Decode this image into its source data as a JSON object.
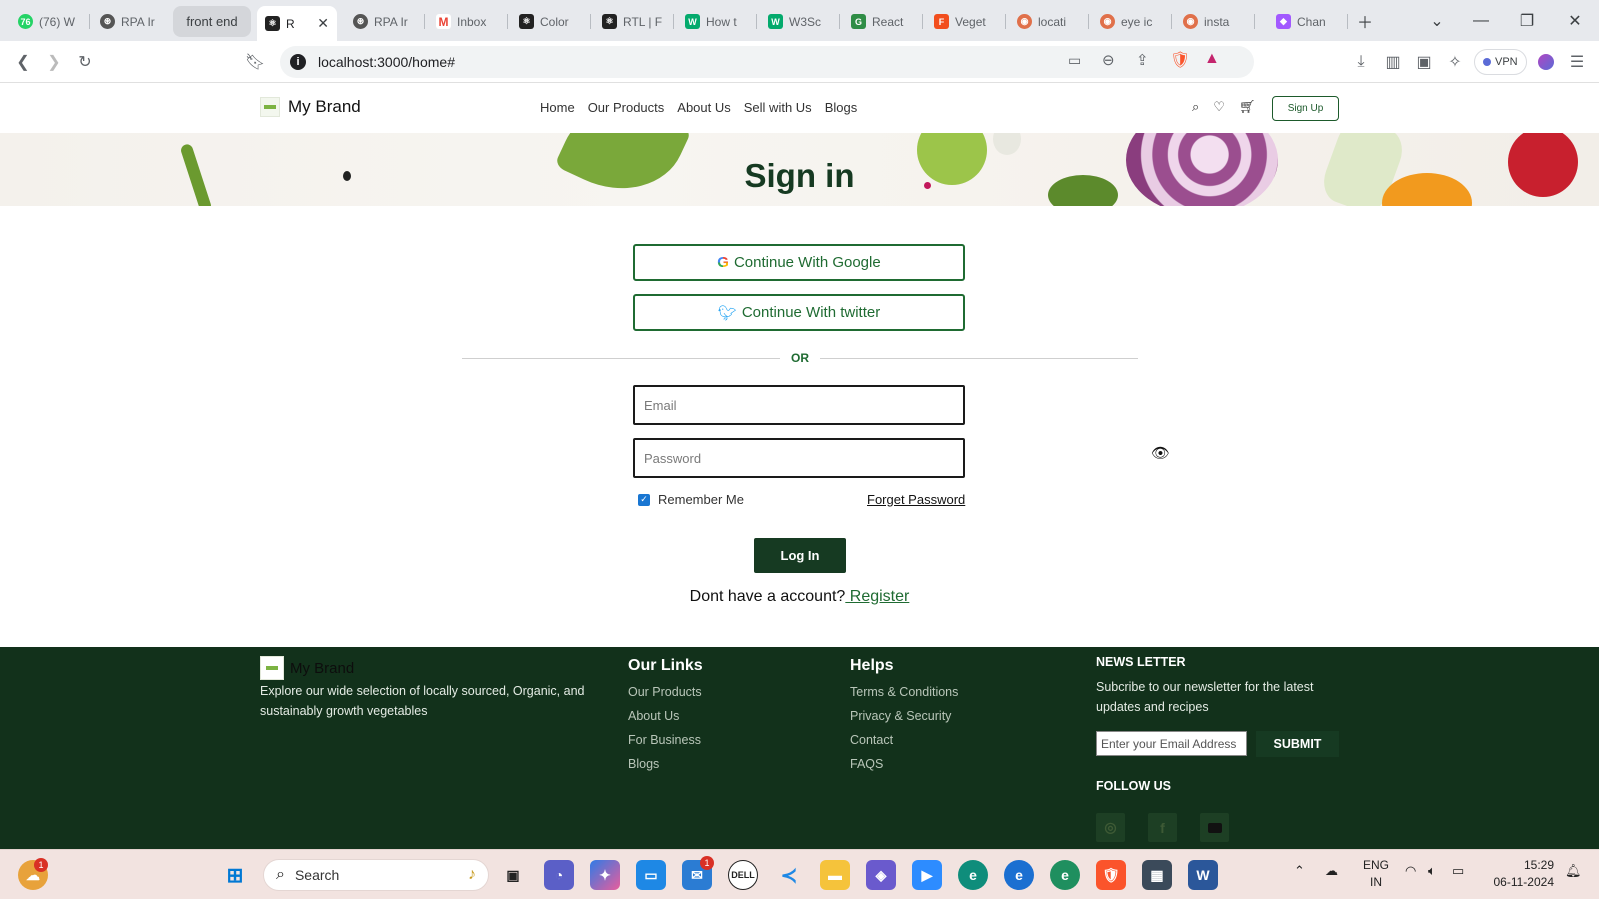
{
  "browser": {
    "tabs": [
      {
        "label": "(76) W",
        "icon": "whatsapp-icon",
        "color": "#25d366"
      },
      {
        "label": "RPA Ir",
        "icon": "openai-icon",
        "color": "#444444"
      },
      {
        "label": "front end",
        "icon": "",
        "color": ""
      },
      {
        "label": "R",
        "icon": "react-icon",
        "color": "#222222"
      },
      {
        "label": "RPA Ir",
        "icon": "openai-icon",
        "color": "#444444"
      },
      {
        "label": "Inbox",
        "icon": "gmail-icon",
        "color": "#ea4335"
      },
      {
        "label": "Color",
        "icon": "react-icon",
        "color": "#222222"
      },
      {
        "label": "RTL | F",
        "icon": "react-icon",
        "color": "#222222"
      },
      {
        "label": "How t",
        "icon": "w3schools-icon",
        "color": "#04aa6d"
      },
      {
        "label": "W3Sc",
        "icon": "w3schools-icon",
        "color": "#04aa6d"
      },
      {
        "label": "React",
        "icon": "react-geeks-icon",
        "color": "#2f8d46"
      },
      {
        "label": "Veget",
        "icon": "figma-icon",
        "color": "#f24e1e"
      },
      {
        "label": "locati",
        "icon": "brave-search-icon",
        "color": "#e0704a"
      },
      {
        "label": "eye ic",
        "icon": "brave-search-icon",
        "color": "#e0704a"
      },
      {
        "label": "insta",
        "icon": "brave-search-icon",
        "color": "#e0704a"
      },
      {
        "label": "Chan",
        "icon": "figma-ai-icon",
        "color": "#a259ff"
      }
    ],
    "url": "localhost:3000/home#",
    "vpn_label": "VPN"
  },
  "site": {
    "brand": "My Brand",
    "nav": [
      "Home",
      "Our Products",
      "About Us",
      "Sell with Us",
      "Blogs"
    ],
    "signup_label": "Sign Up",
    "hero_title": "Sign in"
  },
  "signin": {
    "google_label": "Continue With Google",
    "twitter_label": "Continue With twitter",
    "or_label": "OR",
    "email_placeholder": "Email",
    "password_placeholder": "Password",
    "remember_label": "Remember Me",
    "remember_checked": true,
    "forget_label": "Forget Password",
    "login_label": "Log In",
    "register_prompt": "Dont have a account?",
    "register_label": " Register"
  },
  "footer": {
    "brand": "My Brand",
    "description": "Explore our wide selection of locally sourced, Organic, and sustainably growth vegetables",
    "links_title": "Our Links",
    "links": [
      "Our Products",
      "About Us",
      "For Business",
      "Blogs"
    ],
    "helps_title": "Helps",
    "helps": [
      "Terms & Conditions",
      "Privacy & Security",
      "Contact",
      "FAQS"
    ],
    "newsletter_title": "NEWS LETTER",
    "newsletter_desc": "Subcribe to our newsletter for the latest updates and recipes",
    "newsletter_placeholder": "Enter your Email Address",
    "submit_label": "SUBMIT",
    "follow_title": "FOLLOW US",
    "social": [
      "instagram-icon",
      "facebook-icon",
      "youtube-icon"
    ]
  },
  "taskbar": {
    "search_label": "Search",
    "language": [
      "ENG",
      "IN"
    ],
    "time": "15:29",
    "date": "06-11-2024",
    "notification_badge": "1",
    "mail_badge": "1"
  },
  "colors": {
    "brand_green": "#163a22",
    "accent_green": "#1f6b32",
    "footer_bg": "#12311b"
  }
}
